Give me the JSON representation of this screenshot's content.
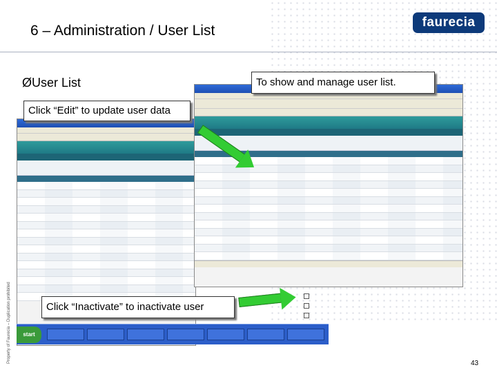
{
  "header": {
    "title": "6 – Administration / User List",
    "logo_text": "faurecia"
  },
  "side_text": "Property of Faurecia – Duplication prohibited",
  "bullet": "ØUser List",
  "callouts": {
    "show_manage": "To show and manage user list.",
    "edit": "Click “Edit” to update user data",
    "inactivate": "Click “Inactivate” to inactivate user"
  },
  "taskbar": {
    "start": "start"
  },
  "footer": {
    "page_number": "43"
  }
}
